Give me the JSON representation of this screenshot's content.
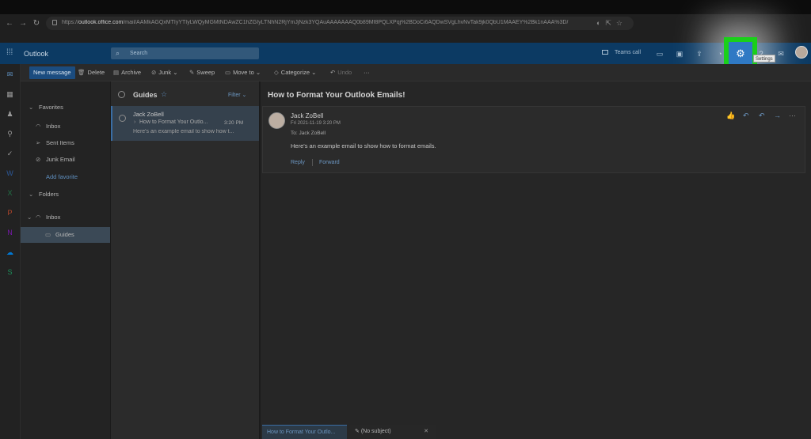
{
  "browser": {
    "url_prefix": "https://",
    "url_domain": "outlook.office.com",
    "url_path": "/mail/AAMkAGQxMTIyYTIyLWQyMGMtNDAwZC1hZGIyLTNhN2RjYmJjNzk3YQAuAAAAAAAQ0b89Mf8PQLXPqj%2BDoCi6AQDwSVgLhvNvTak9jk0QbU1MAAEY%2Bk1nAAA%3D/"
  },
  "header": {
    "app_name": "Outlook",
    "search_placeholder": "Search",
    "teams_call_label": "Teams call",
    "tooltip": "Settings"
  },
  "toolbar": {
    "new_message": "New message",
    "delete": "Delete",
    "archive": "Archive",
    "junk": "Junk",
    "sweep": "Sweep",
    "move_to": "Move to",
    "categorize": "Categorize",
    "undo": "Undo",
    "more": "···"
  },
  "folders": {
    "favorites_header": "Favorites",
    "inbox": "Inbox",
    "sent_items": "Sent Items",
    "junk_email": "Junk Email",
    "add_favorite": "Add favorite",
    "folders_header": "Folders",
    "inbox_folder": "Inbox",
    "guides": "Guides"
  },
  "message_list": {
    "title": "Guides",
    "filter": "Filter",
    "messages": [
      {
        "from": "Jack ZoBell",
        "subject": "How to Format Your Outlo...",
        "time": "3:20 PM",
        "preview": "Here's an example email to show how t..."
      }
    ]
  },
  "reading_pane": {
    "subject": "How to Format Your Outlook Emails!",
    "sender": "Jack ZoBell",
    "date": "Fri 2021-11-19 3:20 PM",
    "to": "To:  Jack ZoBell",
    "body": "Here's an example email to show how to format emails.",
    "reply": "Reply",
    "forward": "Forward"
  },
  "bottom_tabs": {
    "tab1": "How to Format Your Outlo...",
    "tab2": "(No subject)",
    "close": "✕"
  },
  "colors": {
    "header_bg": "#0c3a63",
    "highlight": "#1ad01a",
    "settings_active": "#2f79c4",
    "link": "#6c97c2"
  }
}
